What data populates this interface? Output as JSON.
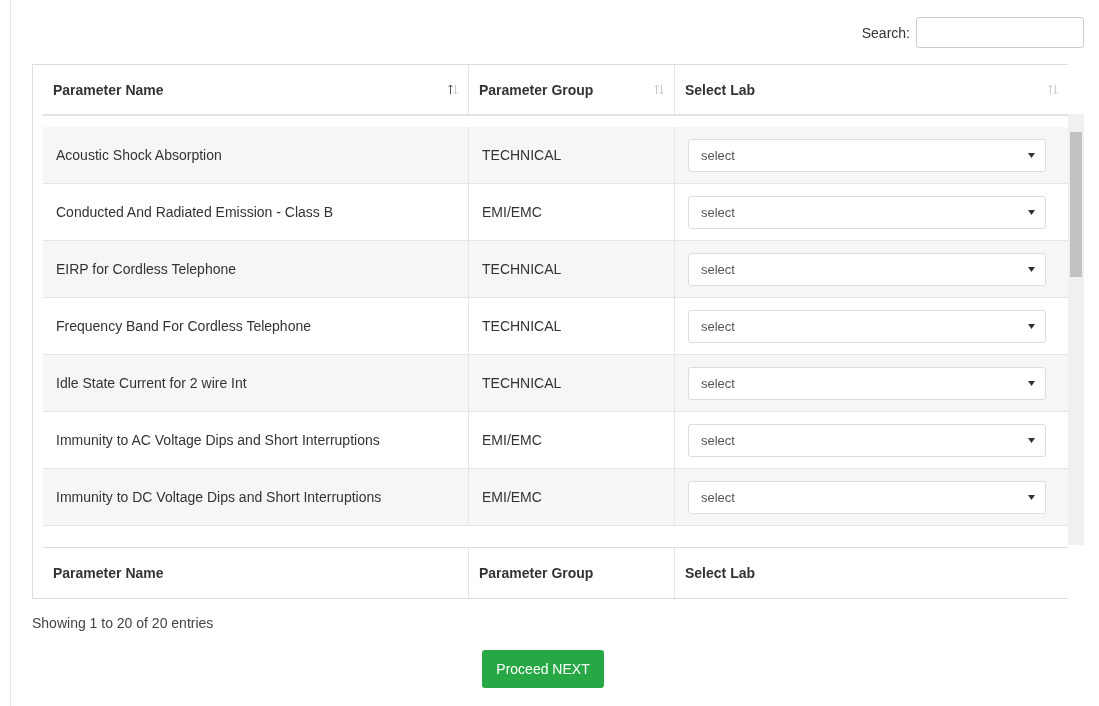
{
  "search": {
    "label": "Search:"
  },
  "table": {
    "columns": [
      {
        "label": "Parameter Name",
        "sorted": true
      },
      {
        "label": "Parameter Group",
        "sorted": false
      },
      {
        "label": "Select Lab",
        "sorted": false
      }
    ],
    "rows": [
      {
        "name": "Acoustic Shock Absorption",
        "group": "TECHNICAL",
        "lab": "select"
      },
      {
        "name": "Conducted And Radiated Emission - Class B",
        "group": "EMI/EMC",
        "lab": "select"
      },
      {
        "name": "EIRP for Cordless Telephone",
        "group": "TECHNICAL",
        "lab": "select"
      },
      {
        "name": "Frequency Band For Cordless Telephone",
        "group": "TECHNICAL",
        "lab": "select"
      },
      {
        "name": "Idle State Current for 2 wire Int",
        "group": "TECHNICAL",
        "lab": "select"
      },
      {
        "name": "Immunity to AC Voltage Dips and Short Interruptions",
        "group": "EMI/EMC",
        "lab": "select"
      },
      {
        "name": "Immunity to DC Voltage Dips and Short Interruptions",
        "group": "EMI/EMC",
        "lab": "select"
      }
    ],
    "footer": [
      "Parameter Name",
      "Parameter Group",
      "Select Lab"
    ]
  },
  "info": "Showing 1 to 20 of 20 entries",
  "button": "Proceed NEXT"
}
